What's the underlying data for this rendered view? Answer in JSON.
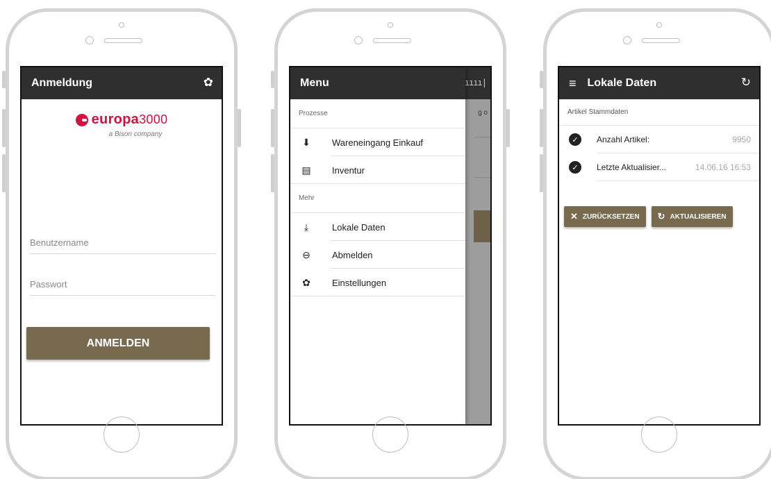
{
  "login": {
    "title": "Anmeldung",
    "settings_icon": "gear-icon",
    "logo_text": "europa",
    "logo_number": "3000",
    "logo_tagline": "a Bison company",
    "username_placeholder": "Benutzername",
    "password_placeholder": "Passwort",
    "login_button": "ANMELDEN",
    "accent_color": "#786a4f",
    "brand_color": "#d3123f"
  },
  "menu": {
    "title": "Menu",
    "background_peek": "g o",
    "sections": [
      {
        "label": "Prozesse",
        "items": [
          {
            "icon": "archive-down-icon",
            "glyph": "⬇",
            "label": "Wareneingang Einkauf"
          },
          {
            "icon": "inbox-tray-icon",
            "glyph": "▤",
            "label": "Inventur"
          }
        ]
      },
      {
        "label": "Mehr",
        "items": [
          {
            "icon": "download-icon",
            "glyph": "⤓",
            "label": "Lokale Daten"
          },
          {
            "icon": "logout-icon",
            "glyph": "⊖",
            "label": "Abmelden"
          },
          {
            "icon": "gear-icon",
            "glyph": "✿",
            "label": "Einstellungen"
          }
        ]
      }
    ]
  },
  "local_data": {
    "title": "Lokale Daten",
    "refresh_icon": "refresh-icon",
    "section_label": "Artikel Stammdaten",
    "rows": [
      {
        "label": "Anzahl Artikel:",
        "value": "9950"
      },
      {
        "label": "Letzte Aktualisier...",
        "value": "14.06.16 16:53"
      }
    ],
    "reset_button": "ZURÜCKSETZEN",
    "update_button": "AKTUALISIEREN"
  }
}
